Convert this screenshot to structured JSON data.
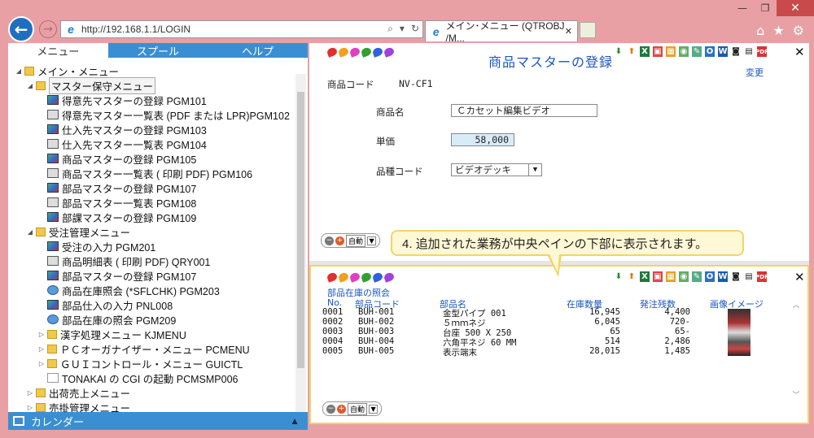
{
  "window": {
    "min": "—",
    "restore": "❐",
    "close": "✕"
  },
  "browser": {
    "url": "http://192.168.1.1/LOGIN",
    "search_icon": "⌕",
    "dropdown": "▾",
    "refresh": "↻",
    "tab_title": "メイン･メニュー (QTROBJ /M...",
    "tab_close": "✕",
    "home": "⌂",
    "star": "★",
    "gear": "⚙"
  },
  "sidebar": {
    "tabs": [
      "メニュー",
      "スプール",
      "ヘルプ"
    ],
    "tree": [
      {
        "indent": 0,
        "tri": "◢",
        "icon": "folder",
        "label": "メイン・メニュー"
      },
      {
        "indent": 1,
        "tri": "◢",
        "icon": "folder",
        "label": "マスター保守メニュー",
        "selected": true
      },
      {
        "indent": 2,
        "tri": "",
        "icon": "pgm",
        "label": "得意先マスターの登録 PGM101"
      },
      {
        "indent": 2,
        "tri": "",
        "icon": "print",
        "label": "得意先マスター一覧表 (PDF または LPR)PGM102"
      },
      {
        "indent": 2,
        "tri": "",
        "icon": "pgm",
        "label": "仕入先マスターの登録 PGM103"
      },
      {
        "indent": 2,
        "tri": "",
        "icon": "print",
        "label": "仕入先マスター一覧表 PGM104"
      },
      {
        "indent": 2,
        "tri": "",
        "icon": "pgm",
        "label": "商品マスターの登録 PGM105"
      },
      {
        "indent": 2,
        "tri": "",
        "icon": "print",
        "label": "商品マスター一覧表 ( 印刷 PDF) PGM106"
      },
      {
        "indent": 2,
        "tri": "",
        "icon": "pgm",
        "label": "部品マスターの登録 PGM107"
      },
      {
        "indent": 2,
        "tri": "",
        "icon": "print",
        "label": "部品マスター一覧表 PGM108"
      },
      {
        "indent": 2,
        "tri": "",
        "icon": "pgm",
        "label": "部課マスターの登録 PGM109"
      },
      {
        "indent": 1,
        "tri": "◢",
        "icon": "folder",
        "label": "受注管理メニュー"
      },
      {
        "indent": 2,
        "tri": "",
        "icon": "pgm",
        "label": "受注の入力 PGM201"
      },
      {
        "indent": 2,
        "tri": "",
        "icon": "print",
        "label": "商品明細表 ( 印刷 PDF) QRY001"
      },
      {
        "indent": 2,
        "tri": "",
        "icon": "pgm",
        "label": "部品マスターの登録 PGM107"
      },
      {
        "indent": 2,
        "tri": "",
        "icon": "globe",
        "label": "商品在庫照会 (*SFLCHK) PGM203"
      },
      {
        "indent": 2,
        "tri": "",
        "icon": "pgm",
        "label": "部品仕入の入力 PNL008"
      },
      {
        "indent": 2,
        "tri": "",
        "icon": "globe",
        "label": "部品在庫の照会 PGM209"
      },
      {
        "indent": 2,
        "tri": "▷",
        "icon": "folder",
        "label": "漢字処理メニュー KJMENU"
      },
      {
        "indent": 2,
        "tri": "▷",
        "icon": "folder",
        "label": "ＰＣオーガナイザー・メニュー PCMENU"
      },
      {
        "indent": 2,
        "tri": "▷",
        "icon": "folder",
        "label": "ＧＵＩコントロール・メニュー GUICTL"
      },
      {
        "indent": 2,
        "tri": "",
        "icon": "docu",
        "label": "TONAKAI の CGI の起動 PCMSMP006"
      },
      {
        "indent": 1,
        "tri": "▷",
        "icon": "folder",
        "label": "出荷売上メニュー"
      },
      {
        "indent": 1,
        "tri": "▷",
        "icon": "folder",
        "label": "売掛管理メニュー"
      }
    ],
    "calendar_label": "カレンダー",
    "collapse_icon": "▲"
  },
  "top_pane": {
    "title": "商品マスターの登録",
    "change_link": "変更",
    "product_code_label": "商品コード",
    "product_code_value": "NV-CF1",
    "name_label": "商品名",
    "name_value": "Ｃカセット編集ビデオ",
    "price_label": "単価",
    "price_value": "58,000",
    "category_label": "品種コード",
    "category_value": "ビデオデッキ",
    "zoom_label": "自動",
    "close": "✕"
  },
  "callout": "4. 追加された業務が中央ペインの下部に表示されます。",
  "bottom_pane": {
    "title": "部品在庫の照会",
    "headers": [
      "No.",
      "部品コード",
      "部品名",
      "在庫数量",
      "発注残数",
      "画像イメージ"
    ],
    "rows": [
      [
        "0001",
        "BUH-001",
        "金型パイプ 001",
        "16,945",
        "4,400"
      ],
      [
        "0002",
        "BUH-002",
        "５ｍｍネジ",
        "6,045",
        "720-"
      ],
      [
        "0003",
        "BUH-003",
        "台座 500 X 250",
        "65",
        "65-"
      ],
      [
        "0004",
        "BUH-004",
        "六角平ネジ 60 MM",
        "514",
        "2,486"
      ],
      [
        "0005",
        "BUH-005",
        "表示端末",
        "28,015",
        "1,485"
      ]
    ],
    "zoom_label": "自動",
    "close": "✕",
    "scroll_up": "︿",
    "scroll_down": "﹀"
  },
  "pin_colors": [
    "#e03030",
    "#f0a020",
    "#e040c0",
    "#30a030",
    "#3060e0",
    "#a040e0"
  ]
}
